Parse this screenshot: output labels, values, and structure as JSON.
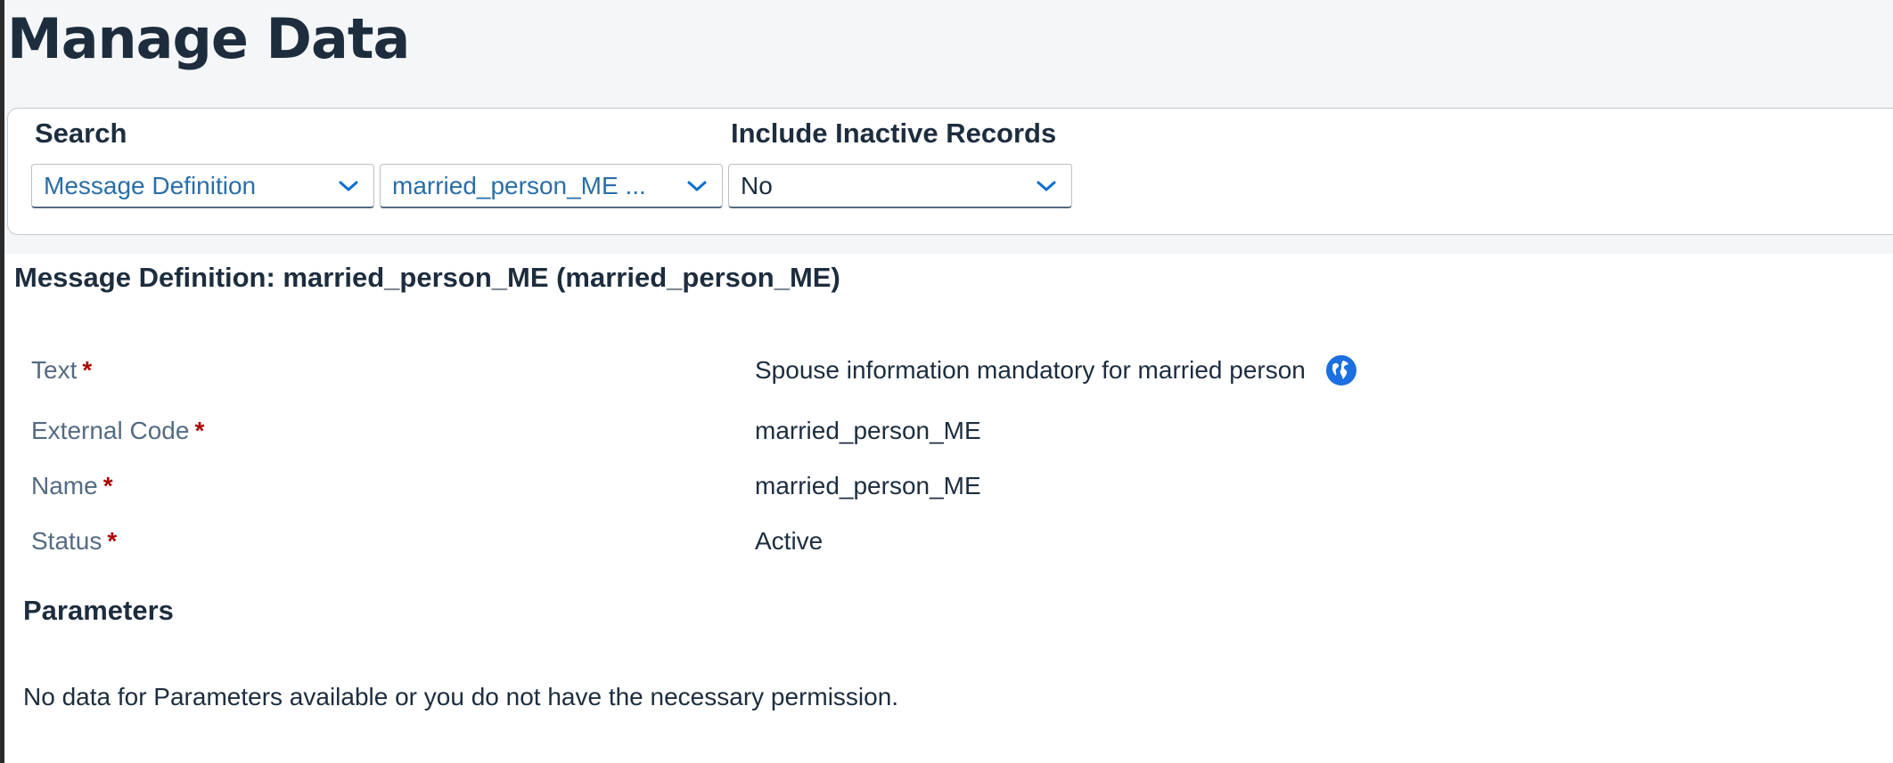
{
  "page": {
    "title": "Manage Data"
  },
  "search": {
    "search_label": "Search",
    "inactive_label": "Include Inactive Records",
    "object_type_value": "Message Definition",
    "record_value": "married_person_ME ...",
    "inactive_value": "No"
  },
  "record": {
    "heading": "Message Definition: married_person_ME (married_person_ME)",
    "fields": [
      {
        "label": "Text",
        "required_marker": "*",
        "value": "Spouse information mandatory for married person"
      },
      {
        "label": "External Code",
        "required_marker": "*",
        "value": "married_person_ME"
      },
      {
        "label": "Name",
        "required_marker": "*",
        "value": "married_person_ME"
      },
      {
        "label": "Status",
        "required_marker": "*",
        "value": "Active"
      }
    ],
    "translation_icon": "globe-icon"
  },
  "parameters": {
    "title": "Parameters",
    "empty_message": "No data for Parameters available or you do not have the necessary permission."
  },
  "colors": {
    "title_text": "#1d2d3e",
    "label_text": "#556b82",
    "link_value": "#2a6ea8",
    "required": "#aa0808",
    "chevron": "#0a6ed1",
    "globe": "#1b6fe0",
    "band_bg": "#f5f6f7"
  }
}
